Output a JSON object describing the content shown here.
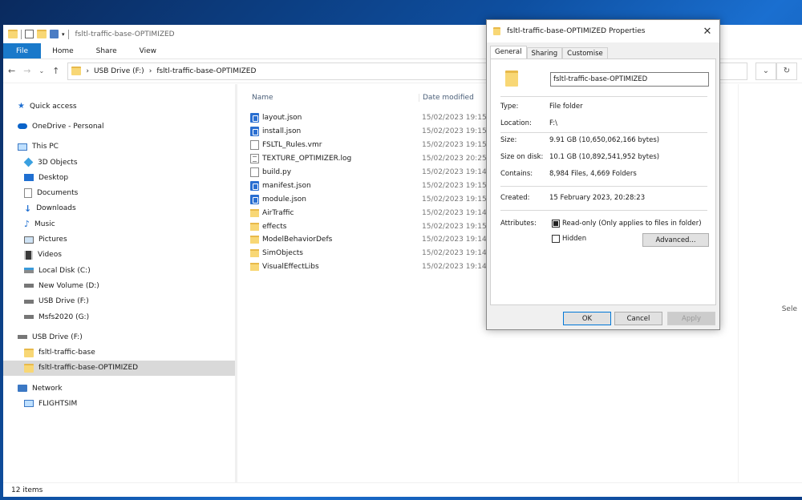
{
  "explorer": {
    "title": "fsltl-traffic-base-OPTIMIZED",
    "ribbon_tabs": [
      "File",
      "Home",
      "Share",
      "View"
    ],
    "address": {
      "segments": [
        "USB Drive (F:)",
        "fsltl-traffic-base-OPTIMIZED"
      ],
      "separator": "›"
    },
    "nav": {
      "quick_access": "Quick access",
      "onedrive": "OneDrive - Personal",
      "this_pc": "This PC",
      "pc_items": [
        "3D Objects",
        "Desktop",
        "Documents",
        "Downloads",
        "Music",
        "Pictures",
        "Videos",
        "Local Disk (C:)",
        "New Volume (D:)",
        "USB Drive (F:)",
        "Msfs2020 (G:)"
      ],
      "usb_drive": "USB Drive (F:)",
      "usb_items": [
        "fsltl-traffic-base",
        "fsltl-traffic-base-OPTIMIZED"
      ],
      "network": "Network",
      "network_items": [
        "FLIGHTSIM"
      ]
    },
    "columns": {
      "name": "Name",
      "date": "Date modified"
    },
    "files": [
      {
        "name": "layout.json",
        "date": "15/02/2023 19:15",
        "icon": "json"
      },
      {
        "name": "install.json",
        "date": "15/02/2023 19:15",
        "icon": "json"
      },
      {
        "name": "FSLTL_Rules.vmr",
        "date": "15/02/2023 19:15",
        "icon": "doc"
      },
      {
        "name": "TEXTURE_OPTIMIZER.log",
        "date": "15/02/2023 20:25",
        "icon": "log"
      },
      {
        "name": "build.py",
        "date": "15/02/2023 19:14",
        "icon": "doc"
      },
      {
        "name": "manifest.json",
        "date": "15/02/2023 19:15",
        "icon": "json"
      },
      {
        "name": "module.json",
        "date": "15/02/2023 19:15",
        "icon": "json"
      },
      {
        "name": "AirTraffic",
        "date": "15/02/2023 19:14",
        "icon": "folder"
      },
      {
        "name": "effects",
        "date": "15/02/2023 19:15",
        "icon": "folder"
      },
      {
        "name": "ModelBehaviorDefs",
        "date": "15/02/2023 19:14",
        "icon": "folder"
      },
      {
        "name": "SimObjects",
        "date": "15/02/2023 19:14",
        "icon": "folder"
      },
      {
        "name": "VisualEffectLibs",
        "date": "15/02/2023 19:14",
        "icon": "folder"
      }
    ],
    "status": "12 items",
    "right_hint": "Sele"
  },
  "dialog": {
    "title": "fsltl-traffic-base-OPTIMIZED Properties",
    "close": "✕",
    "tabs": [
      "General",
      "Sharing",
      "Customise"
    ],
    "name_value": "fsltl-traffic-base-OPTIMIZED",
    "type_label": "Type:",
    "type_value": "File folder",
    "location_label": "Location:",
    "location_value": "F:\\",
    "size_label": "Size:",
    "size_value": "9.91 GB (10,650,062,166 bytes)",
    "size_disk_label": "Size on disk:",
    "size_disk_value": "10.1 GB (10,892,541,952 bytes)",
    "contains_label": "Contains:",
    "contains_value": "8,984 Files, 4,669 Folders",
    "created_label": "Created:",
    "created_value": "15 February 2023, 20:28:23",
    "attributes_label": "Attributes:",
    "readonly_label": "Read-only (Only applies to files in folder)",
    "hidden_label": "Hidden",
    "advanced_label": "Advanced...",
    "ok_label": "OK",
    "cancel_label": "Cancel",
    "apply_label": "Apply"
  },
  "colors": {
    "file_tab": "#1979ca",
    "selection": "#d9d9d9",
    "folder": "#f8d775",
    "json_icon": "#2a6fd1"
  }
}
